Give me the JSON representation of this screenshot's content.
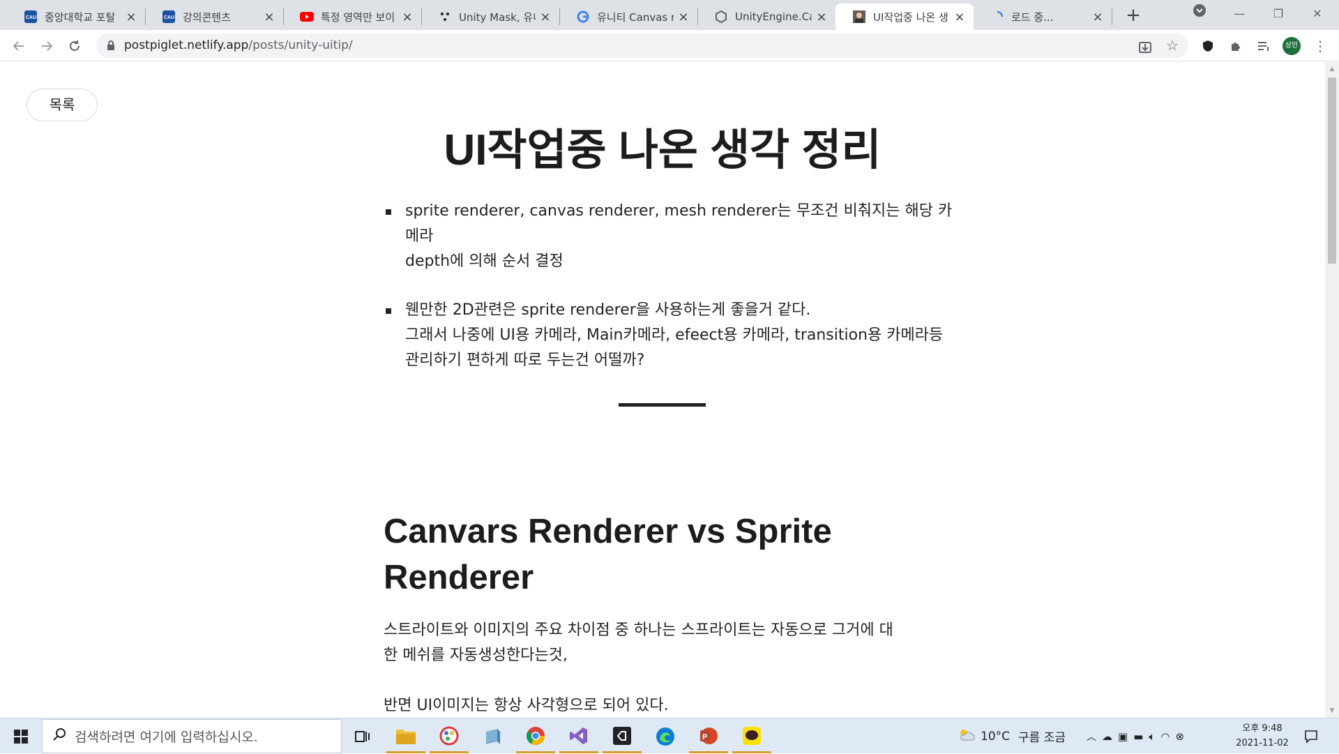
{
  "browser": {
    "tabs": [
      {
        "title": "중앙대학교 포탈",
        "favicon": "cau-logo-icon",
        "active": false
      },
      {
        "title": "강의콘텐츠",
        "favicon": "cau-logo-icon",
        "active": false
      },
      {
        "title": "특정 영역만 보이",
        "favicon": "youtube-icon",
        "active": false
      },
      {
        "title": "Unity Mask, 유니",
        "favicon": "dots-logo-icon",
        "active": false
      },
      {
        "title": "유니티 Canvas re",
        "favicon": "google-icon",
        "active": false
      },
      {
        "title": "UnityEngine.Canv",
        "favicon": "unity-icon",
        "active": false
      },
      {
        "title": "UI작업중 나온 생",
        "favicon": "avatar-favicon-icon",
        "active": true
      },
      {
        "title": "로드 중...",
        "favicon": "loading-spinner-icon",
        "active": false
      }
    ],
    "new_tab": "+",
    "url_host": "postpiglet.netlify.app",
    "url_path": "/posts/unity-uitip/",
    "profile_initials": "상민",
    "accent": "#1a73e8"
  },
  "page": {
    "toc_button": "목록",
    "title": "UI작업중 나온 생각 정리",
    "bullets": [
      [
        "sprite renderer, canvas renderer, mesh renderer는 무조건 비춰지는 해당 카메라",
        "depth에 의해 순서 결정"
      ],
      [
        "웬만한 2D관련은 sprite renderer을 사용하는게 좋을거 같다.",
        "그래서 나중에 UI용 카메라, Main카메라, efeect용 카메라, transition용 카메라등",
        "관리하기 편하게 따로 두는건 어떨까?"
      ]
    ],
    "heading": "Canvars Renderer vs Sprite Renderer",
    "paragraphs": [
      [
        "스트라이트와 이미지의 주요 차이점 중 하나는 스프라이트는 자동으로 그거에 대",
        "한 메쉬를 자동생성한다는것,"
      ],
      [
        "반면 UI이미지는 항상 사각형으로 되어 있다."
      ]
    ]
  },
  "taskbar": {
    "search_placeholder": "검색하려면 여기에 입력하십시오.",
    "weather_temp": "10°C",
    "weather_desc": "구름 조금",
    "clock_time": "오후 9:48",
    "clock_date": "2021-11-02"
  }
}
